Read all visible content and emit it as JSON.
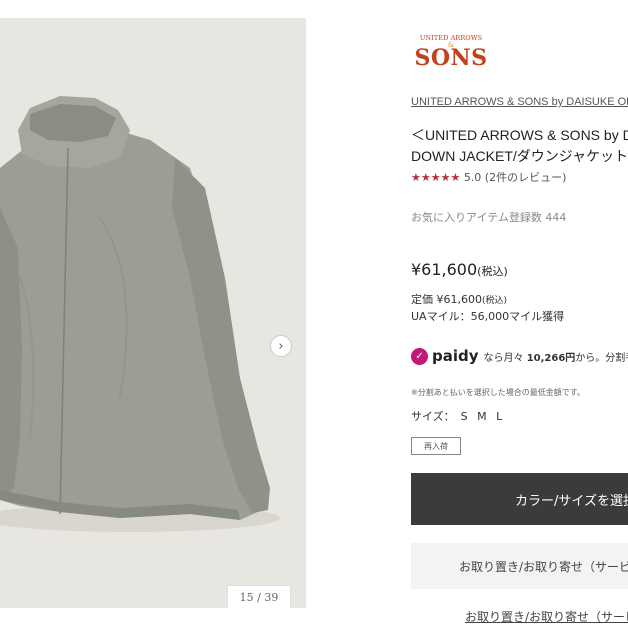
{
  "gallery": {
    "next_icon": "›",
    "counter": "15 / 39"
  },
  "logo": {
    "top": "UNITED ARROWS",
    "amp": "&",
    "main": "SONS"
  },
  "product": {
    "brand": "UNITED ARROWS & SONS by DAISUKE OBANA",
    "title_line1": "＜UNITED ARROWS & SONS by DAISUKE OBANA＞",
    "title_line2": "DOWN JACKET/ダウンジャケット",
    "stars": "★★★★★",
    "rating": "5.0 (2件のレビュー)",
    "favorites": "お気に入りアイテム登録数 444",
    "price": "¥61,600",
    "price_tax": "(税込)",
    "list_price": "定価 ¥61,600",
    "list_price_tax": "(税込)",
    "miles": "UAマイル：56,000マイル獲得",
    "paidy_word": "paidy",
    "paidy_text_pre": "なら月々",
    "paidy_amount": "10,266円",
    "paidy_text_post": "から。分割手数料無料",
    "note": "※分割あと払いを選択した場合の最低金額です。",
    "size_label": "サイズ：",
    "sizes": "S M L",
    "restock": "再入荷"
  },
  "actions": {
    "select_button": "カラー/サイズを選択",
    "hold_button": "お取り置き/お取り寄せ（サービスについて）",
    "hold_link": "お取り置き/お取り寄せ（サービスについて）"
  },
  "colors": {
    "jacket": "#9a9d90",
    "background": "#e8e6e1",
    "logo": "#c2421d",
    "stars": "#b0333d",
    "paidy": "#c2187a"
  }
}
